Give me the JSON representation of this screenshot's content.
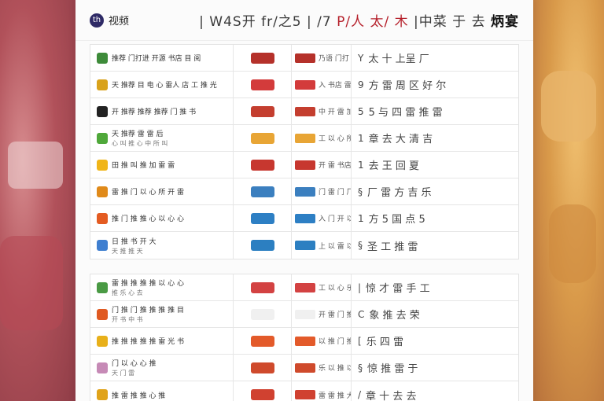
{
  "header": {
    "logo_char": "th",
    "brand": "视频",
    "banner_prefix": "| W4S开",
    "banner_mid": "fr/之5 | /7",
    "banner_accent": "P/人 太/ 木",
    "banner_suffix": "|中菜 于 去",
    "banner_strong": "炳宴"
  },
  "group1": [
    {
      "ic": "#3e8b3a",
      "t1": "推荐 门打进 开源 书店 目 阅",
      "t2": "",
      "tc": "#b5312a",
      "c3": "乃语 门打 推荐",
      "c4mark": "Y",
      "c4": "太 十 上呈 厂"
    },
    {
      "ic": "#d9a21b",
      "t1": "天 推荐 目 电 心 雷人 店 工 推 光",
      "t2": "",
      "tc": "#d33b3b",
      "c3": "入 书店 雷 雷 呢",
      "c4mark": "9",
      "c4": "方 雷 周 区 好 尔"
    },
    {
      "ic": "#222222",
      "t1": "开 推荐 推荐 推荐 门 推 书",
      "t2": "",
      "tc": "#c43e2f",
      "c3": "中 开 雷 加",
      "c4mark": "5",
      "c4": "5 与 四 雷 推 雷"
    },
    {
      "ic": "#4fa83a",
      "t1": "天 推荐 雷 雷 后",
      "t2": "心 叫 推 心 中 所 叫",
      "tc": "#e8a535",
      "c3": "工 以 心 所",
      "c4mark": "1",
      "c4": "章 去 大 清 吉"
    },
    {
      "ic": "#f0b519",
      "t1": "田 推 叫 推 加 雷 雷",
      "t2": "",
      "tc": "#c7372f",
      "c3": "开 雷 书店 开",
      "c4mark": "1",
      "c4": "去 王 回 夏"
    },
    {
      "ic": "#e08a1a",
      "t1": "雷 推 门 以 心 所 开 雷",
      "t2": "",
      "tc": "#3b7fbf",
      "c3": "门 雷 门 厂",
      "c4mark": "§",
      "c4": "厂 雷 方 吉 乐"
    },
    {
      "ic": "#e45c22",
      "t1": "推 门 推 推 心 以 心 心",
      "t2": "",
      "tc": "#2d7fc4",
      "c3": "入 门 开 以",
      "c4mark": "1",
      "c4": "方 5 国 点 5"
    },
    {
      "ic": "#3f7fd0",
      "t1": "日 推 书 开 大",
      "t2": "天 推 推 天",
      "tc": "#2c7fc1",
      "c3": "上 以 雷 以",
      "c4mark": "§",
      "c4": "圣 工 推 雷"
    }
  ],
  "group2": [
    {
      "ic": "#4a9a44",
      "t1": "雷 推 推 推 推 以 心 心",
      "t2": "推 乐 心 去",
      "tc": "#d34242",
      "c3": "工 以 心 乐",
      "c4mark": "|",
      "c4": "惊 才 雷 手 工"
    },
    {
      "ic": "#e05a22",
      "t1": "门 推 门 推 推 推 推 目",
      "t2": "开 书 中 书",
      "tc": "#f0f0f0",
      "c3": "开 雷 门 推",
      "c4mark": "C",
      "c4": "象 推 去 荣"
    },
    {
      "ic": "#e8b01a",
      "t1": "推 推 推 推 推 雷 光 书",
      "t2": "",
      "tc": "#e35a2a",
      "c3": "以 推 门 推",
      "c4mark": "[",
      "c4": "乐 四 雷"
    },
    {
      "ic": "#c68ab6",
      "t1": "门 以 心 心 推",
      "t2": "天 门 雷",
      "tc": "#cf4a2c",
      "c3": "乐 以 推 以",
      "c4mark": "§",
      "c4": "惊 推 雷 于"
    },
    {
      "ic": "#e0a31a",
      "t1": "推 雷 推 推 心 推",
      "t2": "",
      "tc": "#d04130",
      "c3": "雷 雷 推 大",
      "c4mark": "/",
      "c4": "章 十 去 去"
    }
  ]
}
